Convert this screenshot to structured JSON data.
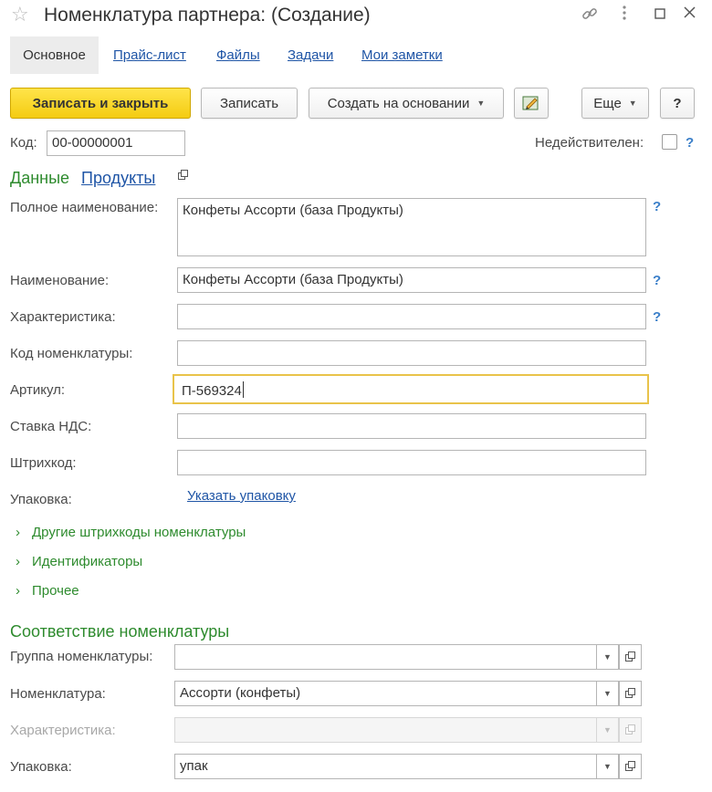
{
  "window": {
    "title": "Номенклатура партнера: (Создание)",
    "icons": [
      "star-icon",
      "link-icon",
      "more-icon",
      "maximize-icon",
      "close-icon"
    ]
  },
  "tabs": [
    {
      "label": "Основное",
      "active": true
    },
    {
      "label": "Прайс-лист"
    },
    {
      "label": "Файлы"
    },
    {
      "label": "Задачи"
    },
    {
      "label": "Мои заметки"
    }
  ],
  "toolbar": {
    "save_close": "Записать и закрыть",
    "save": "Записать",
    "create_based": "Создать на основании",
    "more": "Еще",
    "help": "?"
  },
  "header": {
    "code_label": "Код:",
    "code_value": "00-00000001",
    "invalid_label": "Недействителен:",
    "help": "?"
  },
  "data_section": {
    "title": "Данные",
    "link": "Продукты",
    "fields": {
      "full_name": {
        "label": "Полное наименование:",
        "value": "Конфеты Ассорти (база Продукты)"
      },
      "name": {
        "label": "Наименование:",
        "value": "Конфеты Ассорти (база Продукты)"
      },
      "characteristic": {
        "label": "Характеристика:",
        "value": ""
      },
      "item_code": {
        "label": "Код номенклатуры:",
        "value": ""
      },
      "article": {
        "label": "Артикул:",
        "value": "П-569324"
      },
      "vat_rate": {
        "label": "Ставка НДС:",
        "value": ""
      },
      "barcode": {
        "label": "Штрихкод:",
        "value": ""
      },
      "package": {
        "label": "Упаковка:",
        "link": "Указать упаковку"
      }
    },
    "groups": [
      "Другие штрихкоды номенклатуры",
      "Идентификаторы",
      "Прочее"
    ]
  },
  "mapping_section": {
    "title": "Соответствие номенклатуры",
    "fields": {
      "group": {
        "label": "Группа номенклатуры:",
        "value": ""
      },
      "item": {
        "label": "Номенклатура:",
        "value": "Ассорти (конфеты)"
      },
      "characteristic": {
        "label": "Характеристика:",
        "value": "",
        "disabled": true
      },
      "package": {
        "label": "Упаковка:",
        "value": "упак"
      }
    }
  },
  "colors": {
    "accent_green": "#2e8b2e",
    "link_blue": "#1f55a6",
    "primary_button": "#f4cc12",
    "focus_border": "#e9c34a"
  }
}
